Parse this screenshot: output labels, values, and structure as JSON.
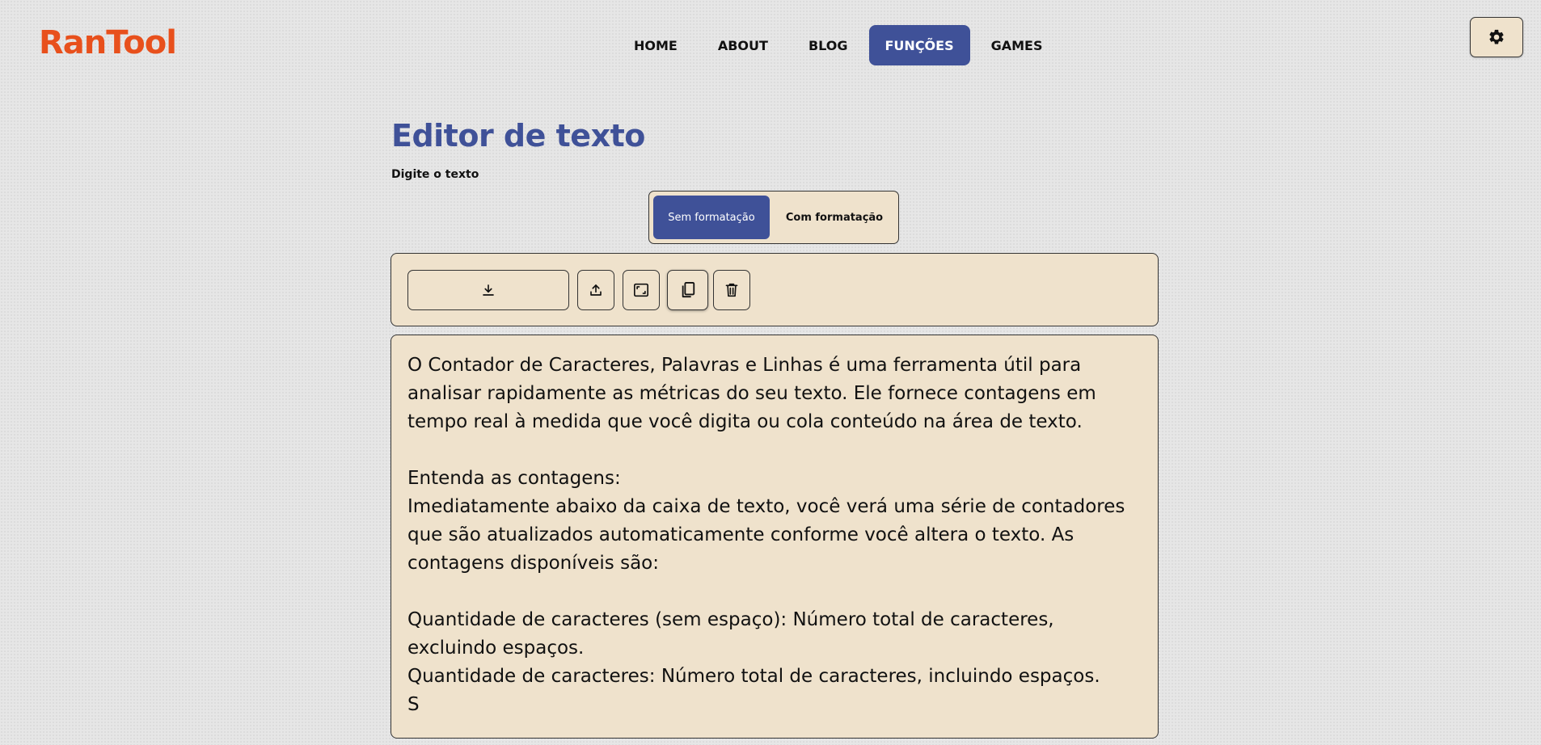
{
  "header": {
    "logo": "RanTool",
    "nav": [
      {
        "label": "HOME",
        "active": false
      },
      {
        "label": "ABOUT",
        "active": false
      },
      {
        "label": "BLOG",
        "active": false
      },
      {
        "label": "FUNÇÕES",
        "active": true
      },
      {
        "label": "GAMES",
        "active": false
      }
    ],
    "settings_icon": "gear-icon"
  },
  "page": {
    "title": "Editor de texto",
    "subtitle": "Digite o texto"
  },
  "modes": {
    "plain_label": "Sem formatação",
    "formatted_label": "Com formatação",
    "selected": "Sem formatação"
  },
  "toolbar": {
    "icons": [
      "download-icon",
      "upload-icon",
      "expand-icon",
      "copy-icon",
      "trash-icon"
    ]
  },
  "editor": {
    "text": "O Contador de Caracteres, Palavras e Linhas é uma ferramenta útil para analisar rapidamente as métricas do seu texto. Ele fornece contagens em tempo real à medida que você digita ou cola conteúdo na área de texto.\n\nEntenda as contagens:\nImediatamente abaixo da caixa de texto, você verá uma série de contadores que são atualizados automaticamente conforme você altera o texto. As contagens disponíveis são:\n\nQuantidade de caracteres (sem espaço): Número total de caracteres, excluindo espaços.\nQuantidade de caracteres: Número total de caracteres, incluindo espaços.\nS"
  },
  "colors": {
    "brand": "#e8501c",
    "accent": "#3f5198",
    "panel": "#efe2cc"
  }
}
